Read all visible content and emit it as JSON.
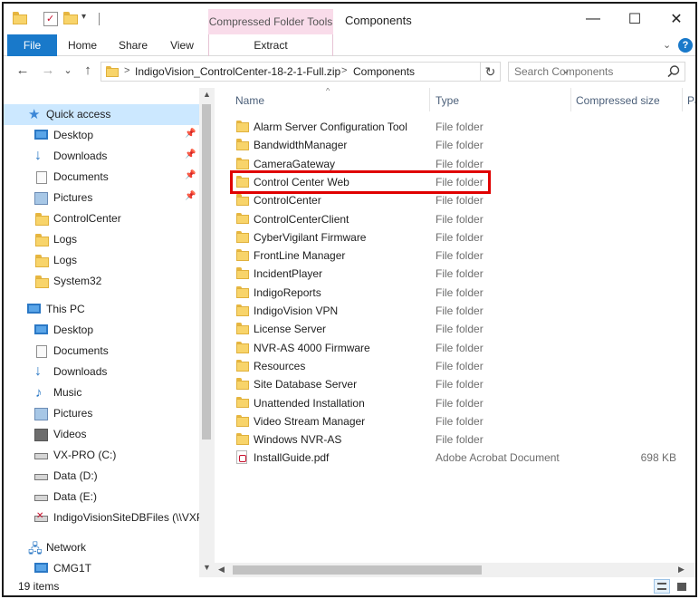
{
  "window": {
    "title": "Components",
    "context_tab": "Compressed Folder Tools",
    "minimize_glyph": "—",
    "maximize_glyph": "☐",
    "close_glyph": "✕"
  },
  "ribbon": {
    "tabs": [
      "File",
      "Home",
      "Share",
      "View"
    ],
    "context_subtab": "Extract",
    "collapse_glyph": "⌄",
    "help_glyph": "?"
  },
  "address": {
    "back_glyph": "←",
    "forward_glyph": "→",
    "recent_glyph": "⌄",
    "up_glyph": "↑",
    "separator": ">",
    "crumbs": [
      "IndigoVision_ControlCenter-18-2-1-Full.zip",
      "Components"
    ],
    "dropdown_glyph": "⌄",
    "refresh_glyph": "↻"
  },
  "search": {
    "placeholder": "Search Components"
  },
  "nav": {
    "quick_access": "Quick access",
    "quick_items": [
      {
        "label": "Desktop",
        "icon": "desktop-icon",
        "pinned": true
      },
      {
        "label": "Downloads",
        "icon": "downloads-icon",
        "pinned": true
      },
      {
        "label": "Documents",
        "icon": "documents-icon",
        "pinned": true
      },
      {
        "label": "Pictures",
        "icon": "pictures-icon",
        "pinned": true
      },
      {
        "label": "ControlCenter",
        "icon": "folder-icon",
        "pinned": false
      },
      {
        "label": "Logs",
        "icon": "folder-icon",
        "pinned": false
      },
      {
        "label": "Logs",
        "icon": "folder-icon",
        "pinned": false
      },
      {
        "label": "System32",
        "icon": "folder-icon",
        "pinned": false
      }
    ],
    "this_pc": "This PC",
    "pc_items": [
      {
        "label": "Desktop",
        "icon": "desktop-icon"
      },
      {
        "label": "Documents",
        "icon": "documents-icon"
      },
      {
        "label": "Downloads",
        "icon": "downloads-icon"
      },
      {
        "label": "Music",
        "icon": "music-icon"
      },
      {
        "label": "Pictures",
        "icon": "pictures-icon"
      },
      {
        "label": "Videos",
        "icon": "videos-icon"
      },
      {
        "label": "VX-PRO (C:)",
        "icon": "drive-icon"
      },
      {
        "label": "Data (D:)",
        "icon": "drive-icon"
      },
      {
        "label": "Data (E:)",
        "icon": "drive-icon"
      },
      {
        "label": "IndigoVisionSiteDBFiles (\\\\VXPR",
        "icon": "network-drive-icon"
      }
    ],
    "network": "Network",
    "network_items": [
      {
        "label": "CMG1T",
        "icon": "computer-icon"
      }
    ]
  },
  "columns": {
    "name": "Name",
    "type": "Type",
    "size": "Compressed size",
    "extra": "Pa"
  },
  "files": [
    {
      "name": "Alarm Server Configuration Tool",
      "type": "File folder",
      "size": "",
      "kind": "folder"
    },
    {
      "name": "BandwidthManager",
      "type": "File folder",
      "size": "",
      "kind": "folder"
    },
    {
      "name": "CameraGateway",
      "type": "File folder",
      "size": "",
      "kind": "folder"
    },
    {
      "name": "Control Center Web",
      "type": "File folder",
      "size": "",
      "kind": "folder",
      "highlighted": true
    },
    {
      "name": "ControlCenter",
      "type": "File folder",
      "size": "",
      "kind": "folder"
    },
    {
      "name": "ControlCenterClient",
      "type": "File folder",
      "size": "",
      "kind": "folder"
    },
    {
      "name": "CyberVigilant Firmware",
      "type": "File folder",
      "size": "",
      "kind": "folder"
    },
    {
      "name": "FrontLine Manager",
      "type": "File folder",
      "size": "",
      "kind": "folder"
    },
    {
      "name": "IncidentPlayer",
      "type": "File folder",
      "size": "",
      "kind": "folder"
    },
    {
      "name": "IndigoReports",
      "type": "File folder",
      "size": "",
      "kind": "folder"
    },
    {
      "name": "IndigoVision VPN",
      "type": "File folder",
      "size": "",
      "kind": "folder"
    },
    {
      "name": "License Server",
      "type": "File folder",
      "size": "",
      "kind": "folder"
    },
    {
      "name": "NVR-AS 4000 Firmware",
      "type": "File folder",
      "size": "",
      "kind": "folder"
    },
    {
      "name": "Resources",
      "type": "File folder",
      "size": "",
      "kind": "folder"
    },
    {
      "name": "Site Database Server",
      "type": "File folder",
      "size": "",
      "kind": "folder"
    },
    {
      "name": "Unattended Installation",
      "type": "File folder",
      "size": "",
      "kind": "folder"
    },
    {
      "name": "Video Stream Manager",
      "type": "File folder",
      "size": "",
      "kind": "folder"
    },
    {
      "name": "Windows NVR-AS",
      "type": "File folder",
      "size": "",
      "kind": "folder"
    },
    {
      "name": "InstallGuide.pdf",
      "type": "Adobe Acrobat Document",
      "size": "698 KB",
      "kind": "pdf"
    }
  ],
  "status": {
    "item_count": "19 items"
  },
  "colors": {
    "accent": "#1979ca",
    "context_tab": "#f9dcea",
    "selection": "#cce8ff",
    "highlight_box": "#e00000",
    "folder": "#f8d46a"
  }
}
